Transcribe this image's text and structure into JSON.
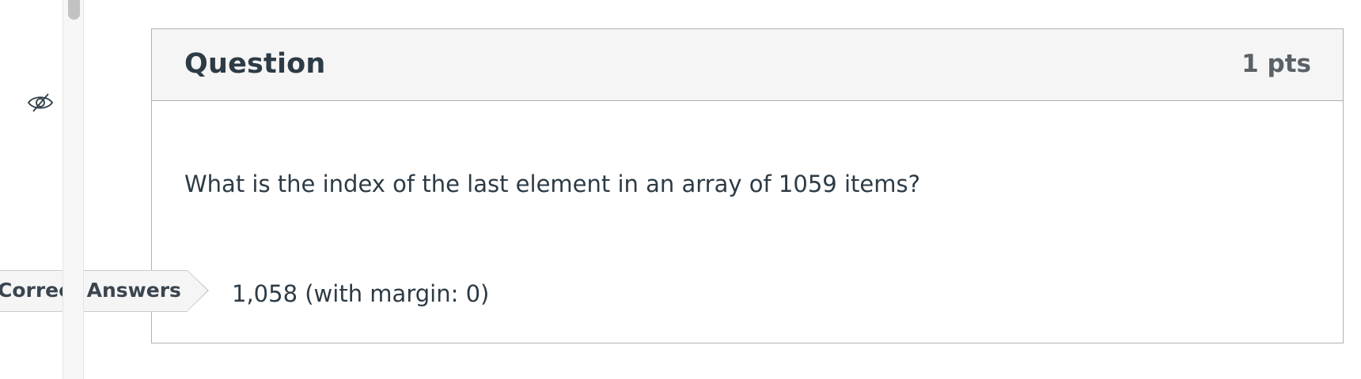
{
  "question": {
    "title": "Question",
    "points": "1 pts",
    "text": "What is the index of the last element in an array of 1059 items?"
  },
  "answer": {
    "tag_label": "Correct Answers",
    "value": "1,058 (with margin: 0)"
  },
  "icons": {
    "visibility": "eye-off-icon"
  },
  "colors": {
    "header_background": "#f5f5f5",
    "text_primary": "#2d3b45",
    "border": "#aeb1b5"
  }
}
